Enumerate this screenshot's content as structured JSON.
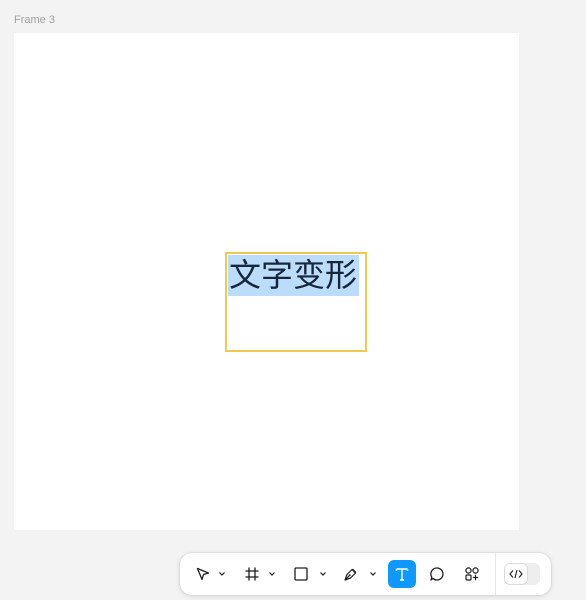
{
  "frame": {
    "label": "Frame 3"
  },
  "canvas_text": {
    "content": "文字变形"
  },
  "toolbar": {
    "tools": [
      {
        "name": "move-tool",
        "icon": "cursor-arrow-icon",
        "has_caret": true
      },
      {
        "name": "frame-tool",
        "icon": "hash-frame-icon",
        "has_caret": true
      },
      {
        "name": "shape-tool",
        "icon": "rectangle-icon",
        "has_caret": true
      },
      {
        "name": "pen-tool",
        "icon": "pen-icon",
        "has_caret": true
      },
      {
        "name": "text-tool",
        "icon": "text-t-icon",
        "active": true
      },
      {
        "name": "comment-tool",
        "icon": "comment-bubble-icon"
      },
      {
        "name": "actions-tool",
        "icon": "shapes-plus-icon"
      }
    ],
    "dev_mode": {
      "icon": "code-brackets-icon",
      "enabled": false
    }
  },
  "colors": {
    "accent": "#0d99ff",
    "selection_border": "#f2c94c",
    "text_highlight": "#bcdcfb",
    "text": "#15273a"
  }
}
